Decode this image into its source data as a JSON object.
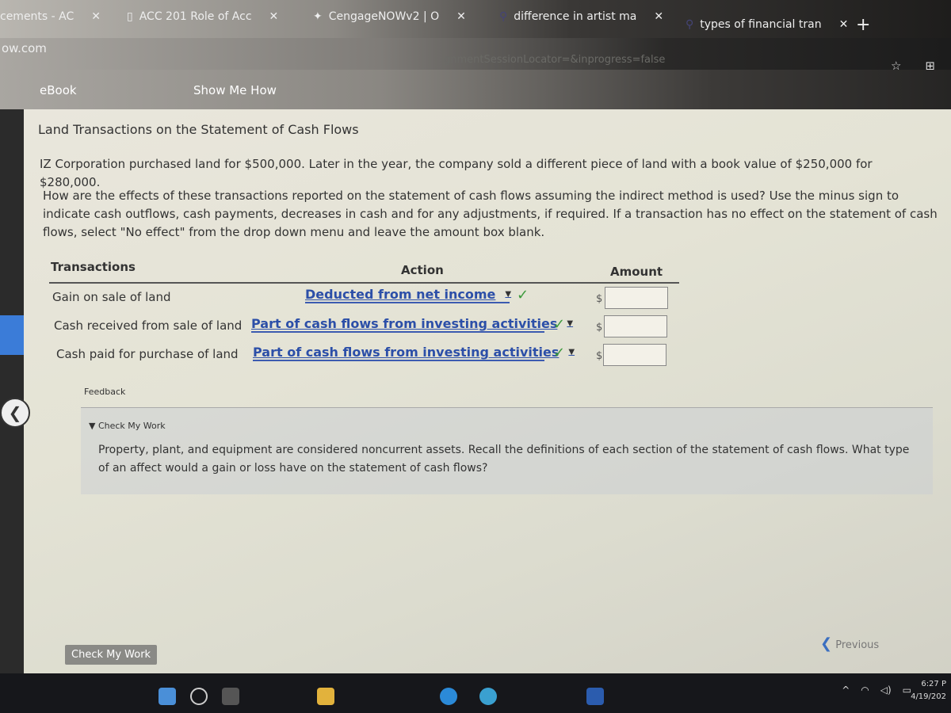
{
  "browser": {
    "tabs": [
      {
        "title": "cements - AC"
      },
      {
        "title": "ACC 201 Role of Acc"
      },
      {
        "title": "CengageNOWv2 | O"
      },
      {
        "title": "difference in artist ma"
      },
      {
        "title": "types of financial tran"
      }
    ],
    "host": "ow.com",
    "url_fragment": "gnmentSessionLocator=&inprogress=false"
  },
  "toolbar": {
    "ebook": "eBook",
    "show_me_how": "Show Me How"
  },
  "question": {
    "title": "Land Transactions on the Statement of Cash Flows",
    "prompt": "IZ Corporation purchased land for $500,000. Later in the year, the company sold a different piece of land with a book value of $250,000 for $280,000.",
    "instructions": "How are the effects of these transactions reported on the statement of cash flows assuming the indirect method is used? Use the minus sign to indicate cash outflows, cash payments, decreases in cash and for any adjustments, if required. If a transaction has no effect on the statement of cash flows, select \"No effect\" from the drop down menu and leave the amount box blank."
  },
  "table": {
    "headers": {
      "transactions": "Transactions",
      "action": "Action",
      "amount": "Amount"
    },
    "currency": "$",
    "rows": [
      {
        "transaction": "Gain on sale of land",
        "action": "Deducted from net income",
        "amount": "",
        "correct": true
      },
      {
        "transaction": "Cash received from sale of land",
        "action": "Part of cash flows from investing activities",
        "amount": "",
        "correct": true
      },
      {
        "transaction": "Cash paid for purchase of land",
        "action": "Part of cash flows from investing activities",
        "amount": "",
        "correct": true
      }
    ]
  },
  "feedback": {
    "label": "Feedback",
    "check_label": "Check My Work",
    "text": "Property, plant, and equipment are considered noncurrent assets. Recall the definitions of each section of the statement of cash flows. What type of an affect would a gain or loss have on the statement of cash flows?"
  },
  "footer": {
    "check_button": "Check My Work",
    "previous": "Previous"
  },
  "taskbar": {
    "time": "6:27 P",
    "date": "4/19/202"
  },
  "colors": {
    "link_blue": "#2c4fa8",
    "check_green": "#3b9a3b"
  }
}
